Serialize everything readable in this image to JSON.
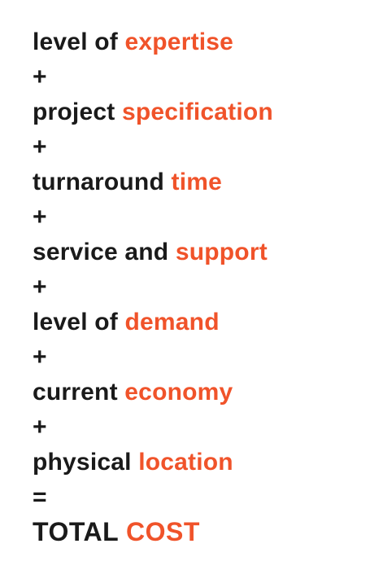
{
  "colors": {
    "text": "#1a1a1a",
    "accent": "#f0532a"
  },
  "factors": [
    {
      "prefix": "level of ",
      "highlight": "expertise"
    },
    {
      "prefix": "project ",
      "highlight": "specification"
    },
    {
      "prefix": "turnaround ",
      "highlight": "time"
    },
    {
      "prefix": "service and ",
      "highlight": "support"
    },
    {
      "prefix": "level of ",
      "highlight": "demand"
    },
    {
      "prefix": "current ",
      "highlight": "economy"
    },
    {
      "prefix": "physical ",
      "highlight": "location"
    }
  ],
  "plus_sign": "+",
  "equals_sign": "=",
  "total": {
    "prefix": "TOTAL ",
    "highlight": "COST"
  }
}
